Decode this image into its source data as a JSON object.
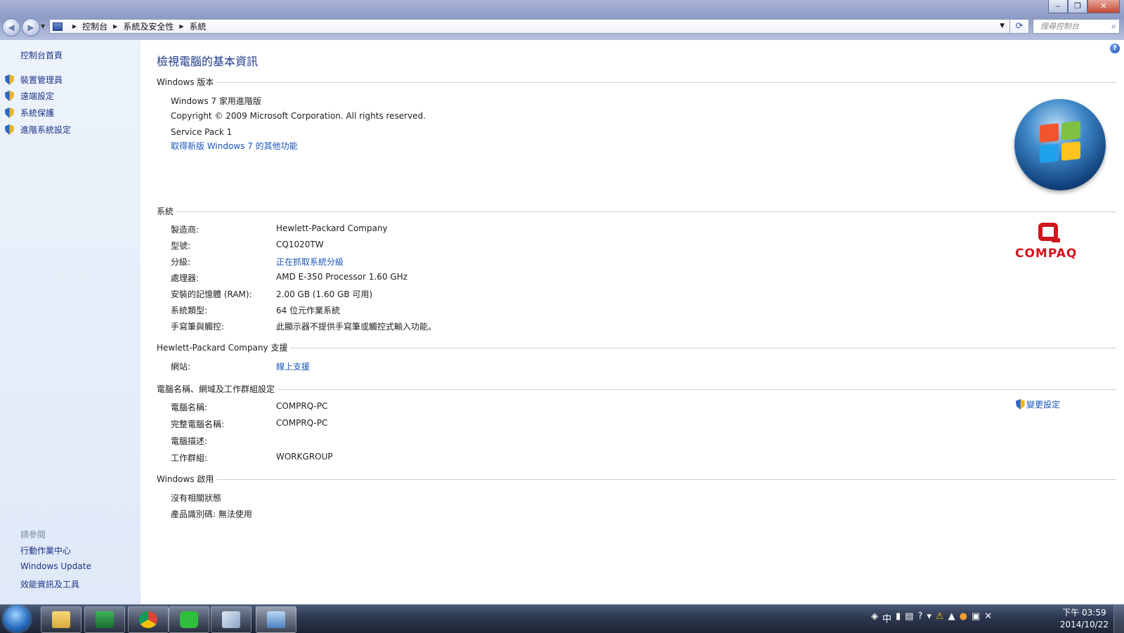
{
  "window": {
    "minimize_glyph": "‒",
    "restore_glyph": "❐",
    "close_glyph": "✕"
  },
  "address_bar": {
    "breadcrumbs": [
      "控制台",
      "系統及安全性",
      "系統"
    ],
    "search_placeholder": "搜尋控制台"
  },
  "sidebar": {
    "home": "控制台首頁",
    "tasks": [
      "裝置管理員",
      "遠端設定",
      "系統保護",
      "進階系統設定"
    ],
    "see_also_title": "請參閱",
    "see_also": [
      "行動作業中心",
      "Windows Update",
      "效能資訊及工具"
    ]
  },
  "main": {
    "title": "檢視電腦的基本資訊",
    "edition": {
      "heading": "Windows 版本",
      "name": "Windows 7 家用進階版",
      "copyright": "Copyright © 2009 Microsoft Corporation.  All rights reserved.",
      "service_pack": "Service Pack 1",
      "upgrade_link": "取得新版 Windows 7 的其他功能"
    },
    "system": {
      "heading": "系統",
      "rows": [
        {
          "label": "製造商:",
          "value": "Hewlett-Packard Company"
        },
        {
          "label": "型號:",
          "value": "CQ1020TW"
        },
        {
          "label": "分級:",
          "value": "正在抓取系統分級"
        },
        {
          "label": "處理器:",
          "value": "AMD E-350 Processor   1.60 GHz"
        },
        {
          "label": "安裝的記憶體 (RAM):",
          "value": "2.00 GB (1.60 GB 可用)"
        },
        {
          "label": "系統類型:",
          "value": "64 位元作業系統"
        },
        {
          "label": "手寫筆與觸控:",
          "value": "此顯示器不提供手寫筆或觸控式輸入功能。"
        }
      ],
      "oem_logo_text": "COMPAQ"
    },
    "support": {
      "heading": "Hewlett-Packard Company 支援",
      "label": "網站:",
      "link": "線上支援"
    },
    "computer_name": {
      "heading": "電腦名稱、網域及工作群組設定",
      "change_link": "變更設定",
      "rows": [
        {
          "label": "電腦名稱:",
          "value": "COMPRQ-PC"
        },
        {
          "label": "完整電腦名稱:",
          "value": "COMPRQ-PC"
        },
        {
          "label": "電腦描述:",
          "value": ""
        },
        {
          "label": "工作群組:",
          "value": "WORKGROUP"
        }
      ]
    },
    "activation": {
      "heading": "Windows 啟用",
      "status": "沒有相關狀態",
      "product_id": "產品識別碼: 無法使用"
    }
  },
  "taskbar": {
    "tray_ime": "中",
    "clock_time": "下午 03:59",
    "clock_date": "2014/10/22"
  },
  "colors": {
    "link": "#1a56b8",
    "title": "#1e3a8a",
    "compaq_red": "#d1151d"
  }
}
